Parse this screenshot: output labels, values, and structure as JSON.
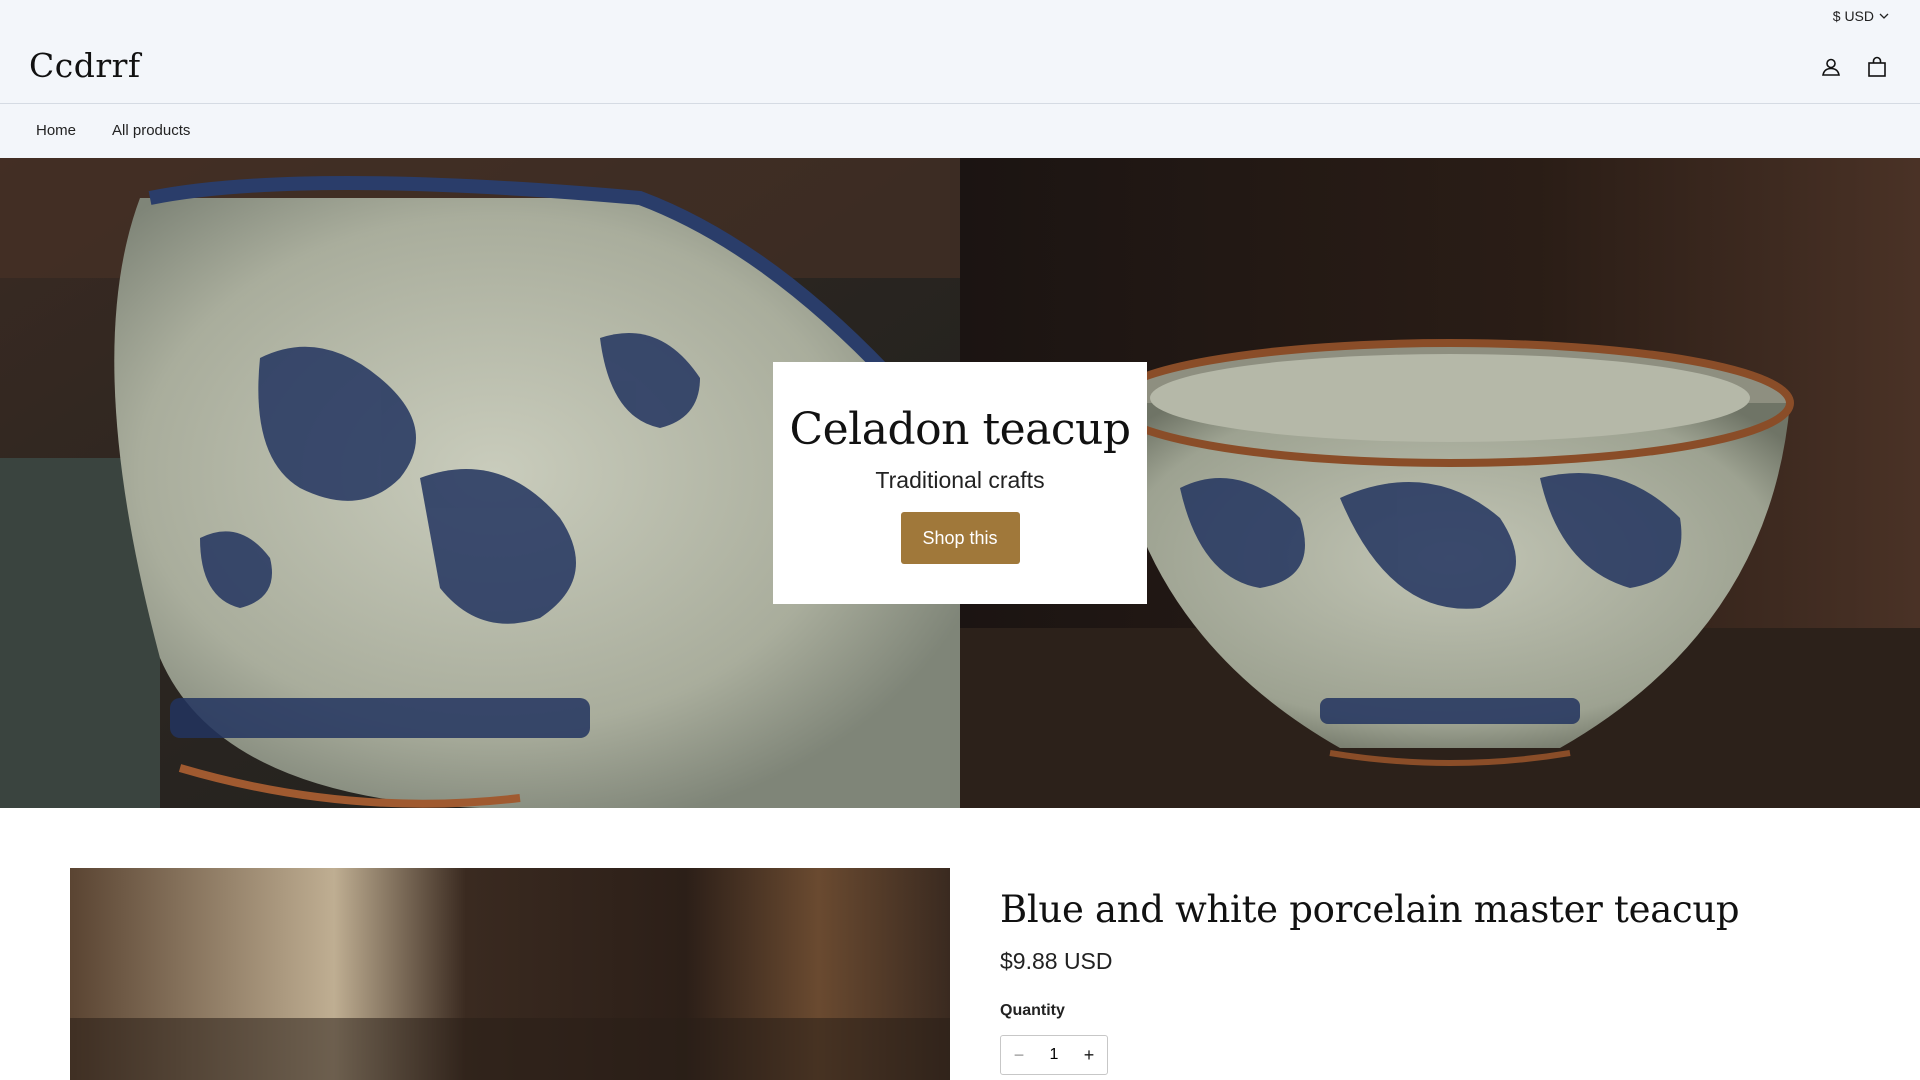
{
  "header": {
    "currency": "$ USD",
    "logo": "Ccdrrf"
  },
  "nav": {
    "items": [
      {
        "label": "Home"
      },
      {
        "label": "All products"
      }
    ]
  },
  "hero": {
    "title": "Celadon teacup",
    "subtitle": "Traditional crafts",
    "button_label": "Shop this"
  },
  "product": {
    "title": "Blue and white porcelain master teacup",
    "price": "$9.88 USD",
    "quantity_label": "Quantity",
    "quantity_value": "1",
    "minus_symbol": "−",
    "plus_symbol": "+"
  },
  "colors": {
    "header_bg": "#f3f6fa",
    "accent": "#a0783a"
  },
  "icons": [
    "chevron-down-icon",
    "account-icon",
    "cart-icon",
    "minus-icon",
    "plus-icon"
  ]
}
